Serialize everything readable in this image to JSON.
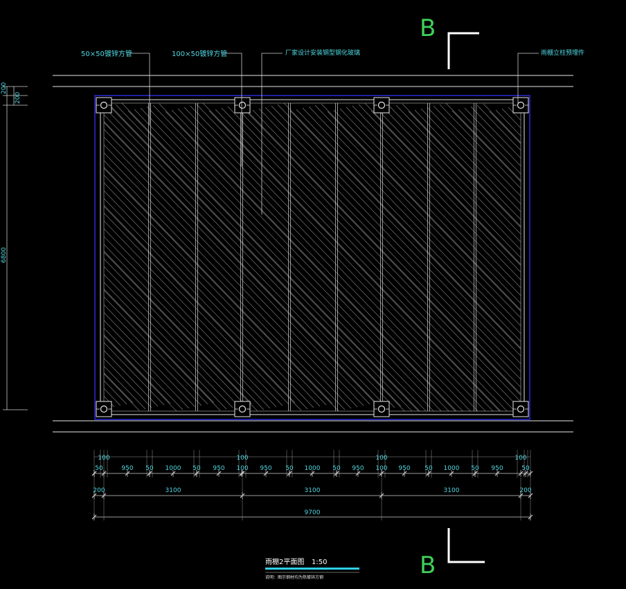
{
  "section_marks": {
    "top": "B",
    "bottom": "B"
  },
  "leaders": {
    "tube_small": "50×50镀锌方管",
    "tube_large": "100×50镀锌方管",
    "glass": "厂家设计安装钢型钢化玻璃",
    "embed": "雨棚立柱预埋件"
  },
  "left_dims": {
    "a": "200",
    "b": "200",
    "c": "6800"
  },
  "dims_row1": [
    "100",
    "100",
    "100",
    "100"
  ],
  "dims_row2": [
    "50",
    "950",
    "50",
    "1000",
    "50",
    "950",
    "100",
    "950",
    "50",
    "1000",
    "50",
    "950",
    "100",
    "950",
    "50",
    "1000",
    "50",
    "950",
    "50"
  ],
  "dims_row3": [
    "200",
    "3100",
    "3100",
    "3100",
    "200"
  ],
  "dim_total": "9700",
  "title_block": {
    "title": "雨棚2平面图",
    "scale": "1:50",
    "note": "说明：图示钢材均为热镀锌方钢"
  },
  "colors": {
    "cyan": "#4fd9e3",
    "green": "#3fd05a",
    "blue": "#2a2ad6",
    "white": "#e8e8e8"
  }
}
